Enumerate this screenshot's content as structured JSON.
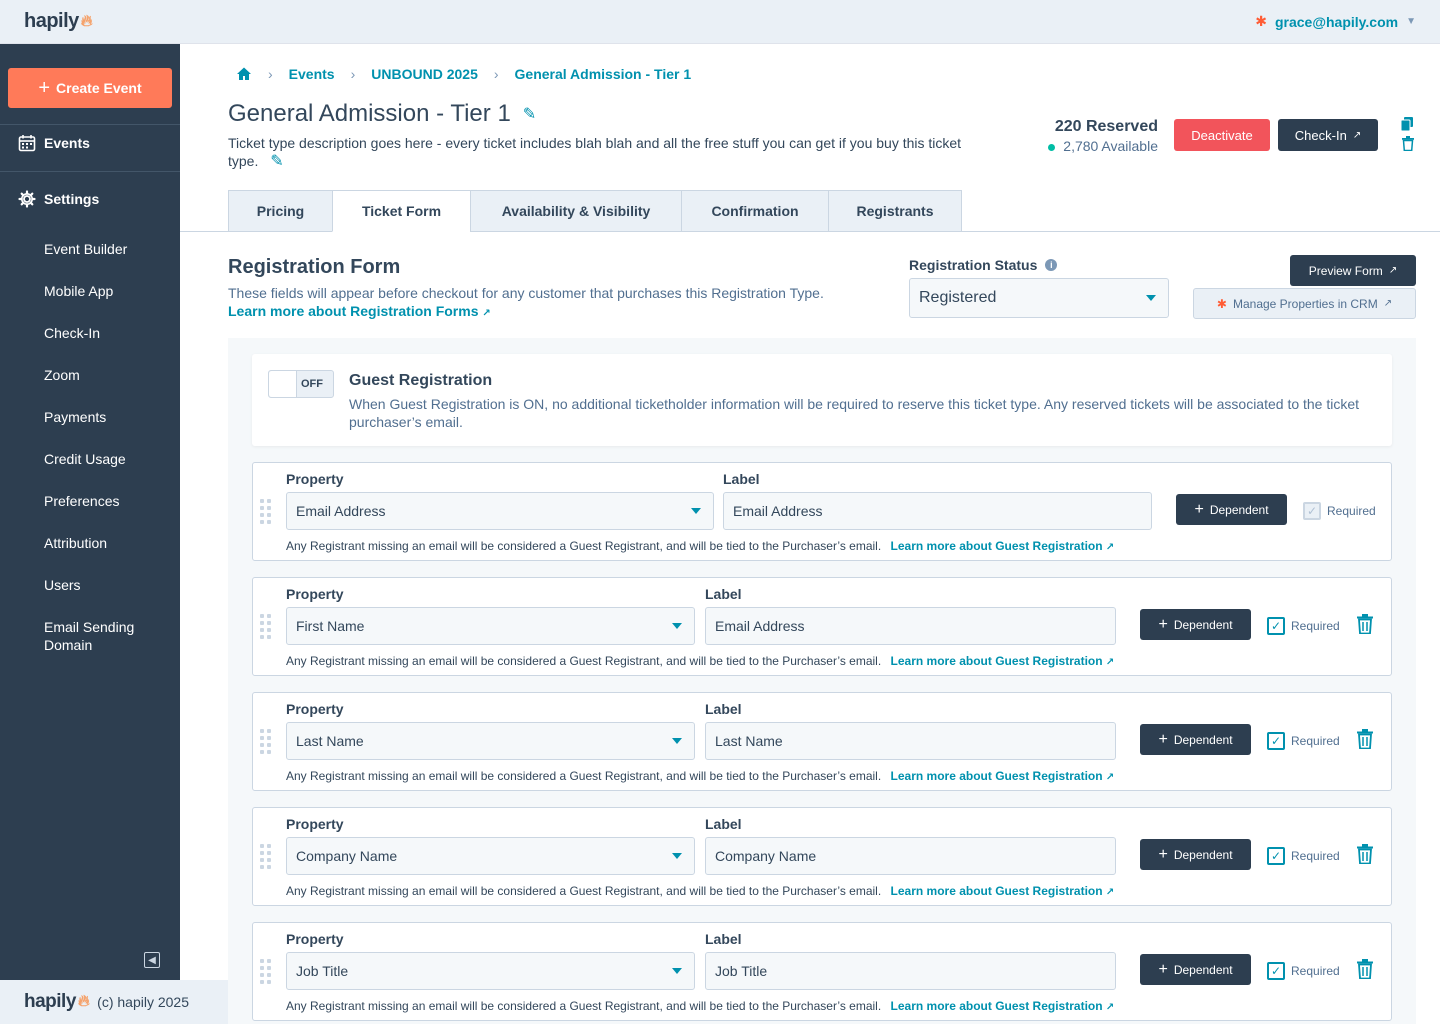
{
  "app": {
    "logo": "hapily",
    "user_email": "grace@hapily.com"
  },
  "sidebar": {
    "create_label": "Create Event",
    "events_label": "Events",
    "settings_label": "Settings",
    "items": [
      "Event Builder",
      "Mobile App",
      "Check-In",
      "Zoom",
      "Payments",
      "Credit Usage",
      "Preferences",
      "Attribution",
      "Users",
      "Email Sending Domain"
    ]
  },
  "footer": {
    "logo": "hapily",
    "copyright": "(c) hapily 2025"
  },
  "breadcrumb": [
    "Events",
    "UNBOUND 2025",
    "General Admission - Tier 1"
  ],
  "ticket": {
    "title": "General Admission - Tier 1",
    "description": "Ticket type description goes here - every ticket includes blah blah and all the free stuff you can get if you buy this ticket type.",
    "reserved": "220 Reserved",
    "available": "2,780 Available",
    "deactivate_label": "Deactivate",
    "checkin_label": "Check-In"
  },
  "tabs": [
    "Pricing",
    "Ticket Form",
    "Availability & Visibility",
    "Confirmation",
    "Registrants"
  ],
  "active_tab": "Ticket Form",
  "form": {
    "title": "Registration Form",
    "description": "These fields will appear before checkout for any customer that purchases this Registration Type.",
    "learn_link": "Learn more about Registration Forms",
    "status_label": "Registration Status",
    "status_value": "Registered",
    "preview_label": "Preview Form",
    "crm_label": "Manage Properties in CRM"
  },
  "guest": {
    "toggle": "OFF",
    "title": "Guest Registration",
    "description": "When Guest Registration is ON, no additional ticketholder information will be required to reserve this ticket type. Any reserved tickets will be associated to the ticket purchaser’s email."
  },
  "field_labels": {
    "property": "Property",
    "label": "Label",
    "dependent": "Dependent",
    "required": "Required"
  },
  "field_note": "Any Registrant missing an email will be considered a Guest Registrant, and will be tied to the Purchaser’s email.",
  "field_link": "Learn more about Guest Registration",
  "fields": [
    {
      "property": "Email Address",
      "label": "Email Address",
      "required": true,
      "locked": true
    },
    {
      "property": "First Name",
      "label": "Email Address",
      "required": true,
      "locked": false
    },
    {
      "property": "Last Name",
      "label": "Last Name",
      "required": true,
      "locked": false
    },
    {
      "property": "Company Name",
      "label": "Company Name",
      "required": true,
      "locked": false
    },
    {
      "property": "Job Title",
      "label": "Job Title",
      "required": true,
      "locked": false
    }
  ],
  "colors": {
    "accent": "#0091ae",
    "primary_dark": "#2d3e50",
    "danger": "#f2545b",
    "create": "#ff7a59"
  }
}
